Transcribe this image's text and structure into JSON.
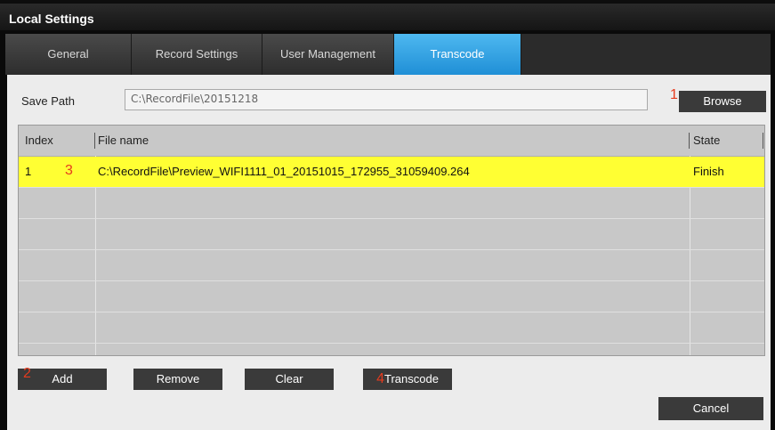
{
  "window": {
    "title": "Local Settings"
  },
  "tabs": [
    {
      "label": "General",
      "active": false
    },
    {
      "label": "Record Settings",
      "active": false
    },
    {
      "label": "User Management",
      "active": false
    },
    {
      "label": "Transcode",
      "active": true
    }
  ],
  "save_path": {
    "label": "Save Path",
    "value": "C:\\RecordFile\\20151218",
    "browse_label": "Browse"
  },
  "table": {
    "columns": [
      "Index",
      "File name",
      "State"
    ],
    "rows": [
      {
        "index": "1",
        "file_name": "C:\\RecordFile\\Preview_WIFI1111_01_20151015_172955_31059409.264",
        "state": "Finish",
        "selected": true
      }
    ]
  },
  "actions": {
    "add_label": "Add",
    "remove_label": "Remove",
    "clear_label": "Clear",
    "transcode_label": "Transcode",
    "cancel_label": "Cancel"
  },
  "markers": {
    "browse": "1",
    "add": "2",
    "row": "3",
    "transcode": "4"
  },
  "colors": {
    "accent_tab": "#2a9be0",
    "selected_row": "#ffff33",
    "marker": "#e63b1e",
    "button": "#3a3a3a"
  }
}
